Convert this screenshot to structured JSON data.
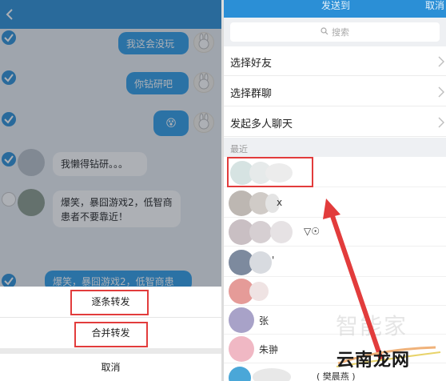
{
  "left_panel": {
    "messages": [
      {
        "side": "right",
        "text": "我这会没玩"
      },
      {
        "side": "right",
        "text": "你钻研吧"
      },
      {
        "side": "right",
        "text": "😵"
      },
      {
        "side": "left",
        "text": "我懒得钻研。。。"
      },
      {
        "side": "left",
        "text": "爆笑，暴囧游戏2，低智商患者不要靠近！"
      }
    ],
    "partial_bubble_text": "爆笑，暴囧游戏2，低智商患",
    "forward_one_by_one": "逐条转发",
    "merge_forward": "合并转发",
    "cancel": "取消"
  },
  "right_panel": {
    "title": "发送到",
    "cancel": "取消",
    "search_placeholder": "搜索",
    "menu": [
      {
        "label": "选择好友"
      },
      {
        "label": "选择群聊"
      },
      {
        "label": "发起多人聊天"
      }
    ],
    "recent_label": "最近",
    "contacts": [
      {
        "name": "",
        "tail": ""
      },
      {
        "name": "",
        "tail": "x"
      },
      {
        "name": "",
        "tail": "▽☉"
      },
      {
        "name": "",
        "tail": "'"
      },
      {
        "name": "",
        "tail": ""
      },
      {
        "name": "张",
        "tail": ""
      },
      {
        "name": "朱翀",
        "tail": ""
      },
      {
        "name": "",
        "tail": "( 樊晨燕 )"
      }
    ]
  },
  "watermark": "智能家",
  "logo": "云南龙网",
  "colors": {
    "accent": "#2b8fd6",
    "bubble": "#2e9be6",
    "highlight_red": "#e23c3c"
  }
}
